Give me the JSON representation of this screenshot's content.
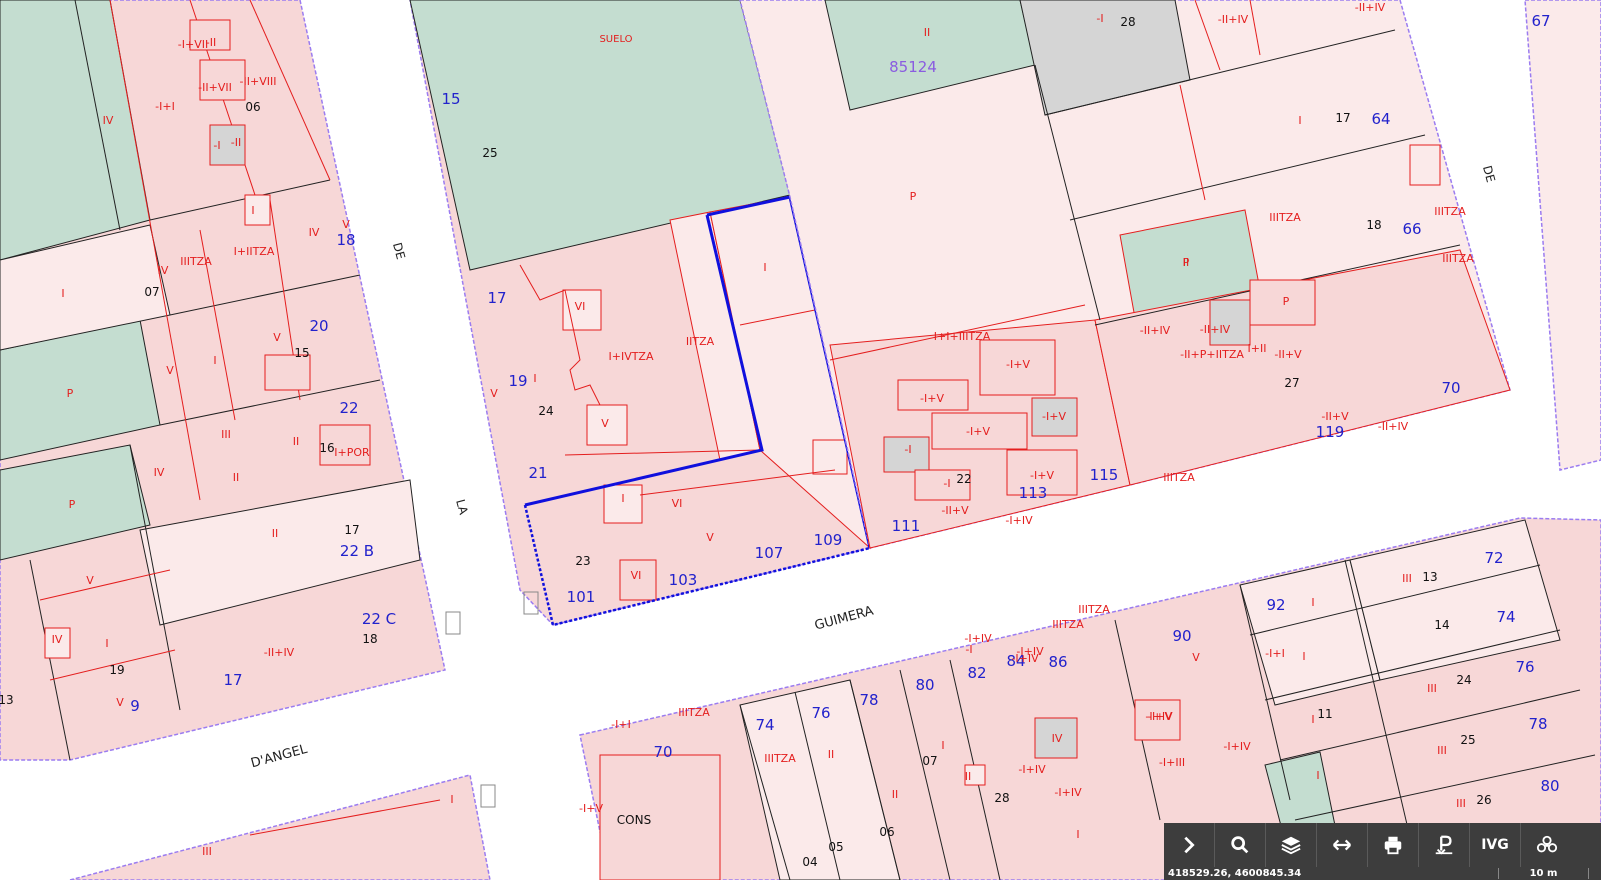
{
  "colors": {
    "parcel_red": "#e41e1e",
    "parcel_fill": "#f7d7d7",
    "parcel_fill_light": "#fbeaea",
    "green_area": "#c4ddd0",
    "grey_area": "#d5d5d5",
    "block_boundary": "#9b7cf0",
    "selected_parcel": "#1010dd",
    "street_number": "#2222cc",
    "toolbar_bg": "#3d3d3d"
  },
  "streets": [
    {
      "text": "DE"
    },
    {
      "text": "LA"
    },
    {
      "text": "DE"
    },
    {
      "text": "GUIMERA"
    },
    {
      "text": "D'ANGEL"
    }
  ],
  "zones": [
    {
      "text": "SUELO"
    },
    {
      "text": "85124"
    }
  ],
  "plot_numbers": [
    "28",
    "06",
    "25",
    "07",
    "15",
    "16",
    "17",
    "18",
    "19",
    "13",
    "24",
    "23",
    "22",
    "17",
    "18",
    "27",
    "13",
    "14",
    "24",
    "11",
    "25",
    "26",
    "07",
    "28",
    "06",
    "05",
    "04",
    "CONS"
  ],
  "house_numbers": [
    "15",
    "17",
    "19",
    "21",
    "101",
    "103",
    "107",
    "109",
    "111",
    "113",
    "115",
    "119",
    "70",
    "66",
    "64",
    "67",
    "20",
    "22",
    "22 B",
    "22 C",
    "17",
    "9",
    "72",
    "74",
    "76",
    "78",
    "80",
    "92",
    "90",
    "86",
    "84",
    "82",
    "80",
    "78",
    "76",
    "74",
    "70",
    "18"
  ],
  "floors": [
    "-I",
    "-II+IV",
    "-II+IV",
    "-I+I",
    "I",
    "II",
    "P",
    "P",
    "-I+I",
    "-II+VII",
    "-II+VIII",
    "-I+VII",
    "-II",
    "-I",
    "-II",
    "I",
    "IV",
    "V",
    "IV",
    "IIITZA",
    "I+IITZA",
    "I",
    "V",
    "I",
    "IV",
    "V",
    "P",
    "III",
    "II",
    "I+POR",
    "II",
    "P",
    "IV",
    "II",
    "V",
    "I",
    "-II+IV",
    "IV",
    "V",
    "I",
    "VI",
    "I+IVTZA",
    "IITZA",
    "V",
    "I",
    "V",
    "I",
    "VI",
    "V",
    "VI",
    "I+I+IIITZA",
    "-I+V",
    "-I+V",
    "-I+V",
    "-I",
    "-I+V",
    "-I",
    "-I+V",
    "-II+V",
    "-I+IV",
    "IIITZA",
    "II",
    "P",
    "-II+IV",
    "-II+IV",
    "-II+P+IITZA",
    "I+II",
    "-II+V",
    "-II+V",
    "-II+IV",
    "IIITZA",
    "IIITZA",
    "IIITZA",
    "III",
    "I",
    "I",
    "III",
    "I",
    "III",
    "I",
    "III",
    "-I+IV",
    "-I+IV",
    "IIITZA",
    "IIITZA",
    "-I+IV",
    "-I+IV",
    "V",
    "-I+IV",
    "IV",
    "-I+IV",
    "-I",
    "-I+III",
    "-I+V",
    "-I+IV",
    "I",
    "II",
    "I",
    "II",
    "II",
    "IIITZA",
    "IIITZA",
    "-I+I",
    "-I+V",
    "III",
    "I"
  ],
  "toolbar": {
    "buttons": [
      {
        "icon": "chevron-right-icon"
      },
      {
        "icon": "search-icon"
      },
      {
        "icon": "layers-icon"
      },
      {
        "icon": "measure-icon"
      },
      {
        "icon": "print-icon"
      },
      {
        "icon": "parking-pin-icon"
      },
      {
        "icon": "ivg-icon",
        "label": "IVG"
      },
      {
        "icon": "cloud-nodes-icon"
      }
    ]
  },
  "status": {
    "coordinates": "418529.26, 4600845.34",
    "scale": "10 m"
  }
}
